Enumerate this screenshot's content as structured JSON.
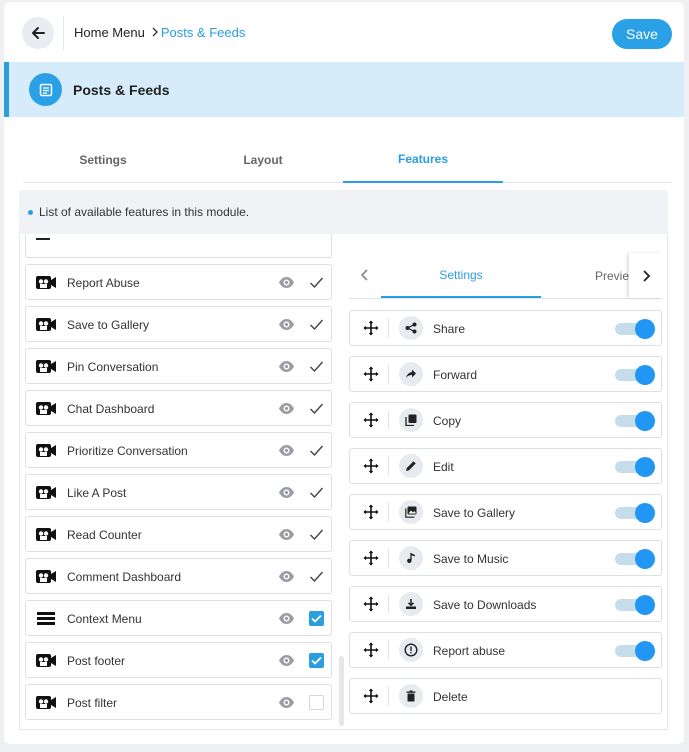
{
  "header": {
    "breadcrumb_home": "Home Menu",
    "breadcrumb_current": "Posts & Feeds",
    "save_label": "Save"
  },
  "banner": {
    "title": "Posts & Feeds"
  },
  "tabs": [
    "Settings",
    "Layout",
    "Features"
  ],
  "active_tab": "Features",
  "info_text": "List of available features in this module.",
  "features": [
    {
      "label": "Report Abuse",
      "state": "checkmark"
    },
    {
      "label": "Save to Gallery",
      "state": "checkmark"
    },
    {
      "label": "Pin Conversation",
      "state": "checkmark"
    },
    {
      "label": "Chat Dashboard",
      "state": "checkmark"
    },
    {
      "label": "Prioritize Conversation",
      "state": "checkmark"
    },
    {
      "label": "Like A Post",
      "state": "checkmark"
    },
    {
      "label": "Read Counter",
      "state": "checkmark"
    },
    {
      "label": "Comment Dashboard",
      "state": "checkmark"
    },
    {
      "label": "Context Menu",
      "state": "checked",
      "icon": "hamburger-icon"
    },
    {
      "label": "Post footer",
      "state": "checked"
    },
    {
      "label": "Post filter",
      "state": "unchecked"
    }
  ],
  "right_panel": {
    "tabs": [
      "Settings",
      "Previe"
    ],
    "actions": [
      {
        "label": "Share",
        "icon": "share-icon",
        "toggle": true
      },
      {
        "label": "Forward",
        "icon": "forward-icon",
        "toggle": true
      },
      {
        "label": "Copy",
        "icon": "copy-icon",
        "toggle": true
      },
      {
        "label": "Edit",
        "icon": "edit-icon",
        "toggle": true
      },
      {
        "label": "Save to Gallery",
        "icon": "gallery-icon",
        "toggle": true
      },
      {
        "label": "Save to Music",
        "icon": "music-icon",
        "toggle": true
      },
      {
        "label": "Save to Downloads",
        "icon": "download-icon",
        "toggle": true
      },
      {
        "label": "Report abuse",
        "icon": "report-icon",
        "toggle": true
      },
      {
        "label": "Delete",
        "icon": "trash-icon",
        "toggle": false
      }
    ]
  },
  "colors": {
    "accent": "#2a9fe0",
    "banner_bg": "#d6ecfa"
  }
}
